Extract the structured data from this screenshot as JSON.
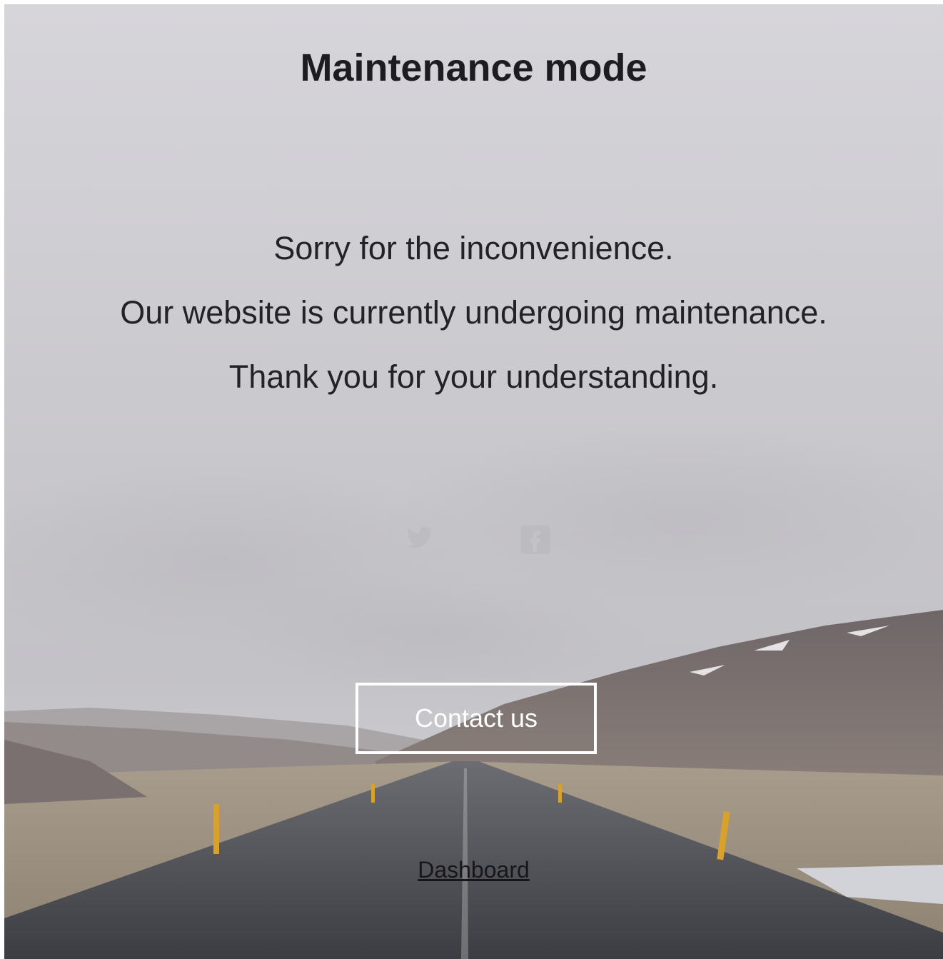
{
  "page": {
    "title": "Maintenance mode",
    "messages": [
      "Sorry for the inconvenience.",
      "Our website is currently undergoing maintenance.",
      "Thank you for your understanding."
    ],
    "contact_button": "Contact us",
    "dashboard_link": "Dashboard"
  },
  "social": [
    {
      "icon": "twitter-icon"
    },
    {
      "icon": "facebook-icon"
    }
  ],
  "colors": {
    "text": "#1d1d21",
    "sky": "#d4d3d8",
    "button_border": "#ffffff"
  }
}
